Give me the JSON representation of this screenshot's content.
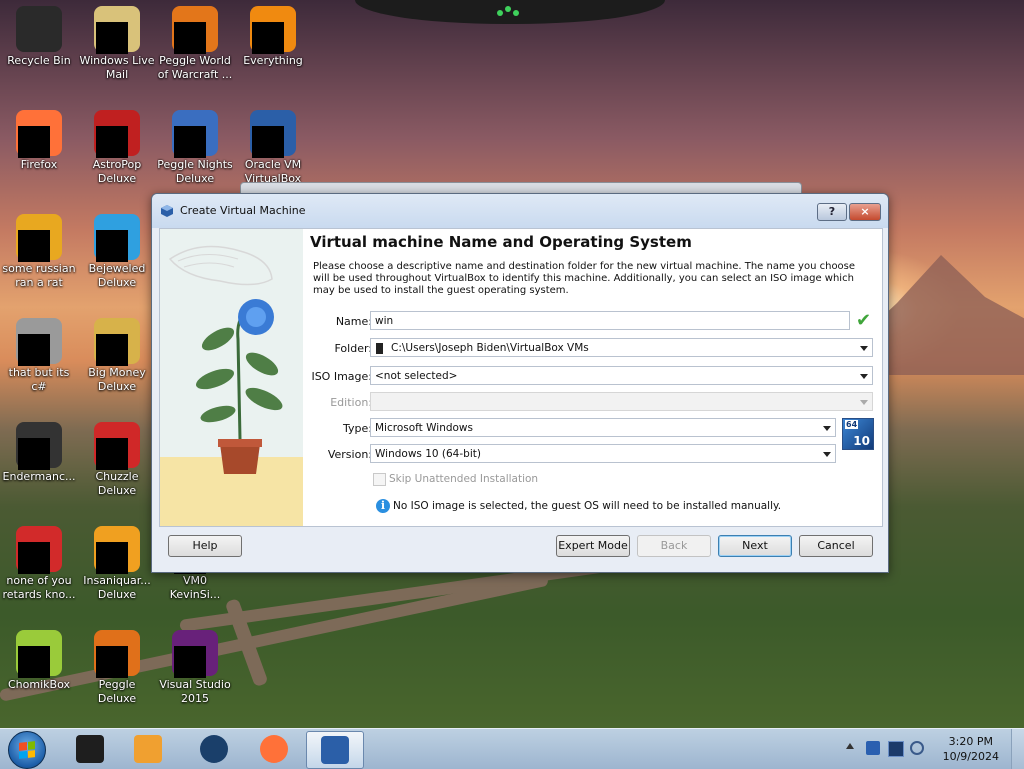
{
  "desktop": {
    "icons": [
      {
        "label": "Recycle Bin",
        "icon": "recycle-bin-icon",
        "color": "#2a2a2a"
      },
      {
        "label": "Windows Live Mail",
        "icon": "windows-live-mail-icon",
        "color": "#d9c27a"
      },
      {
        "label": "Peggle World of Warcraft ...",
        "icon": "peggle-wow-icon",
        "color": "#e3761a"
      },
      {
        "label": "Everything",
        "icon": "everything-icon",
        "color": "#f08a10"
      },
      {
        "label": "Firefox",
        "icon": "firefox-icon",
        "color": "#ff7139"
      },
      {
        "label": "AstroPop Deluxe",
        "icon": "astropop-icon",
        "color": "#c02020"
      },
      {
        "label": "Peggle Nights Deluxe",
        "icon": "peggle-nights-icon",
        "color": "#3a6ec0"
      },
      {
        "label": "Oracle VM VirtualBox",
        "icon": "virtualbox-icon",
        "color": "#2b5fa8"
      },
      {
        "label": "some russian ran a rat",
        "icon": "russian-app-icon",
        "color": "#e8a820"
      },
      {
        "label": "Bejeweled Deluxe",
        "icon": "bejeweled-icon",
        "color": "#2fa0e0"
      },
      {
        "label": "that but its c#",
        "icon": "csharp-app-icon",
        "color": "#9a9a9a"
      },
      {
        "label": "Big Money Deluxe",
        "icon": "big-money-icon",
        "color": "#d7b24a"
      },
      {
        "label": "Endermanc...",
        "icon": "endermanch-icon",
        "color": "#333333"
      },
      {
        "label": "Chuzzle Deluxe",
        "icon": "chuzzle-icon",
        "color": "#d02828"
      },
      {
        "label": "none of you retards kno...",
        "icon": "app-icon",
        "color": "#d22a2a"
      },
      {
        "label": "Insaniquar... Deluxe",
        "icon": "insaniquarium-icon",
        "color": "#f0a020"
      },
      {
        "label": "VM0 KevinSi...",
        "icon": "vm-icon",
        "color": "#444444"
      },
      {
        "label": "ChomikBox",
        "icon": "chomikbox-icon",
        "color": "#9acb3a"
      },
      {
        "label": "Peggle Deluxe",
        "icon": "peggle-deluxe-icon",
        "color": "#e0701a"
      },
      {
        "label": "Visual Studio 2015",
        "icon": "visual-studio-icon",
        "color": "#68217a"
      }
    ]
  },
  "dialog": {
    "title": "Create Virtual Machine",
    "help_glyph": "?",
    "close_glyph": "×",
    "heading": "Virtual machine Name and Operating System",
    "description": "Please choose a descriptive name and destination folder for the new virtual machine. The name you choose will be used throughout VirtualBox to identify this machine. Additionally, you can select an ISO image which may be used to install the guest operating system.",
    "fields": {
      "name_label": "Name:",
      "name_value": "win",
      "folder_label": "Folder:",
      "folder_value": "C:\\Users\\Joseph Biden\\VirtualBox VMs",
      "iso_label": "ISO Image:",
      "iso_value": "<not selected>",
      "edition_label": "Edition:",
      "edition_value": "",
      "type_label": "Type:",
      "type_value": "Microsoft Windows",
      "version_label": "Version:",
      "version_value": "Windows 10 (64-bit)",
      "os_badge_bits": "64",
      "os_badge_version": "10"
    },
    "skip_unattended": "Skip Unattended Installation",
    "info_message": "No ISO image is selected, the guest OS will need to be installed manually.",
    "buttons": {
      "help": "Help",
      "expert_mode": "Expert Mode",
      "back": "Back",
      "next": "Next",
      "cancel": "Cancel"
    }
  },
  "taskbar": {
    "apps": [
      {
        "name": "file-manager",
        "color": "#1e1e1e"
      },
      {
        "name": "media-player",
        "color": "#f0a030"
      },
      {
        "name": "globe-app",
        "color": "#1a3f6a"
      },
      {
        "name": "firefox",
        "color": "#ff7139"
      },
      {
        "name": "virtualbox",
        "color": "#2b5fa8"
      }
    ],
    "clock": {
      "time": "3:20 PM",
      "date": "10/9/2024"
    }
  }
}
